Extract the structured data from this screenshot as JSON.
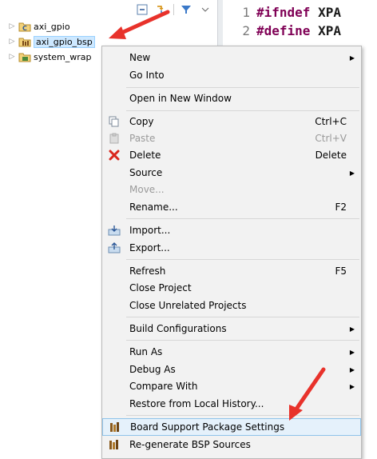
{
  "explorer": {
    "items": [
      {
        "label": "axi_gpio"
      },
      {
        "label": "axi_gpio_bsp"
      },
      {
        "label": "system_wrap"
      }
    ]
  },
  "editor": {
    "lines": [
      {
        "num": "1",
        "kw": "#ifndef",
        "text": "XPA"
      },
      {
        "num": "2",
        "kw": "#define",
        "text": "XPA"
      }
    ]
  },
  "context_menu": {
    "items": [
      {
        "label": "New",
        "submenu": true
      },
      {
        "label": "Go Into"
      },
      {
        "label": "Open in New Window"
      },
      {
        "label": "Copy",
        "shortcut": "Ctrl+C",
        "icon": "copy-icon"
      },
      {
        "label": "Paste",
        "shortcut": "Ctrl+V",
        "icon": "paste-icon",
        "disabled": true
      },
      {
        "label": "Delete",
        "shortcut": "Delete",
        "icon": "delete-icon"
      },
      {
        "label": "Source",
        "submenu": true
      },
      {
        "label": "Move...",
        "disabled": true
      },
      {
        "label": "Rename...",
        "shortcut": "F2"
      },
      {
        "label": "Import...",
        "icon": "import-icon"
      },
      {
        "label": "Export...",
        "icon": "export-icon"
      },
      {
        "label": "Refresh",
        "shortcut": "F5"
      },
      {
        "label": "Close Project"
      },
      {
        "label": "Close Unrelated Projects"
      },
      {
        "label": "Build Configurations",
        "submenu": true
      },
      {
        "label": "Run As",
        "submenu": true
      },
      {
        "label": "Debug As",
        "submenu": true
      },
      {
        "label": "Compare With",
        "submenu": true
      },
      {
        "label": "Restore from Local History..."
      },
      {
        "label": "Board Support Package Settings",
        "icon": "bsp-icon",
        "hovered": true
      },
      {
        "label": "Re-generate BSP Sources",
        "icon": "bsp-icon"
      }
    ]
  },
  "colors": {
    "annotation_arrow": "#e8322b",
    "menu_hover": "#e5f1fb",
    "keyword": "#7f0055"
  }
}
